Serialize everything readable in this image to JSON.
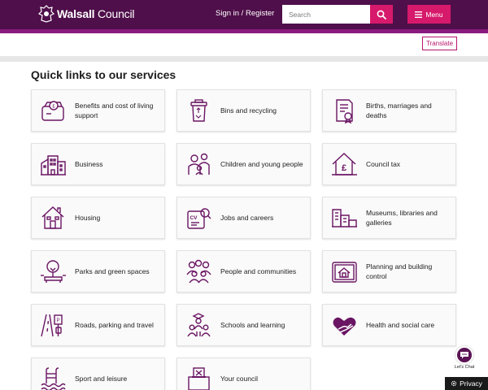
{
  "header": {
    "logo_text_bold": "Walsall",
    "logo_text_rest": " Council",
    "signin_label": "Sign in / Register",
    "search_placeholder": "Search",
    "menu_label": "Menu"
  },
  "translate_label": "Translate",
  "page_title": "Quick links to our services",
  "services": [
    {
      "label": "Benefits and cost of living support",
      "icon": "wallet-icon"
    },
    {
      "label": "Bins and recycling",
      "icon": "bin-icon"
    },
    {
      "label": "Births, marriages and deaths",
      "icon": "certificate-icon"
    },
    {
      "label": "Business",
      "icon": "buildings-icon"
    },
    {
      "label": "Children and young people",
      "icon": "family-icon"
    },
    {
      "label": "Council tax",
      "icon": "house-pound-icon"
    },
    {
      "label": "Housing",
      "icon": "house-icon"
    },
    {
      "label": "Jobs and careers",
      "icon": "cv-search-icon"
    },
    {
      "label": "Museums, libraries and galleries",
      "icon": "museum-icon"
    },
    {
      "label": "Parks and green spaces",
      "icon": "park-icon"
    },
    {
      "label": "People and communities",
      "icon": "people-icon"
    },
    {
      "label": "Planning and building control",
      "icon": "planning-icon"
    },
    {
      "label": "Roads, parking and travel",
      "icon": "road-icon"
    },
    {
      "label": "Schools and learning",
      "icon": "school-icon"
    },
    {
      "label": "Health and social care",
      "icon": "heart-hand-icon"
    },
    {
      "label": "Sport and leisure",
      "icon": "swimming-icon"
    },
    {
      "label": "Your council",
      "icon": "ballot-box-icon"
    }
  ],
  "chat_label": "Let's Chat",
  "privacy_label": "Privacy",
  "colors": {
    "header": "#4f0f4a",
    "header_stripe": "#8a1b7e",
    "accent": "#d6196b",
    "icon": "#6a1563"
  }
}
